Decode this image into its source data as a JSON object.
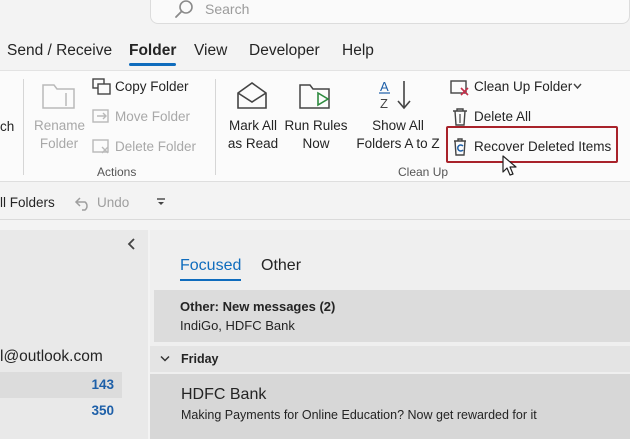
{
  "search": {
    "placeholder": "Search"
  },
  "tabs": [
    "Send / Receive",
    "Folder",
    "View",
    "Developer",
    "Help"
  ],
  "active_tab": "Folder",
  "ribbon": {
    "partial_left_label": "ch",
    "rename_folder": [
      "Rename",
      "Folder"
    ],
    "copy_folder": "Copy Folder",
    "move_folder": "Move Folder",
    "delete_folder": "Delete Folder",
    "actions_group": "Actions",
    "mark_all_as_read": [
      "Mark All",
      "as Read"
    ],
    "run_rules_now": [
      "Run Rules",
      "Now"
    ],
    "show_all_folders": [
      "Show All",
      "Folders A to Z"
    ],
    "clean_up_folder": "Clean Up Folder",
    "delete_all": "Delete All",
    "recover_deleted_items": "Recover Deleted Items",
    "clean_up_group": "Clean Up"
  },
  "quick_access": {
    "all_folders": "ll Folders",
    "undo": "Undo"
  },
  "folder_pane": {
    "account": "l@outlook.com",
    "counts": [
      "143",
      "350"
    ]
  },
  "message_list": {
    "tabs": [
      "Focused",
      "Other"
    ],
    "notice_title": "Other: New messages (2)",
    "notice_senders": "IndiGo, HDFC Bank",
    "date_header": "Friday",
    "message": {
      "sender": "HDFC Bank",
      "subject": "Making Payments for Online Education? Now get rewarded for it"
    }
  },
  "colors": {
    "accent": "#0f6cbd",
    "highlight_box": "#a8222a",
    "count_blue": "#1d5fa8"
  }
}
